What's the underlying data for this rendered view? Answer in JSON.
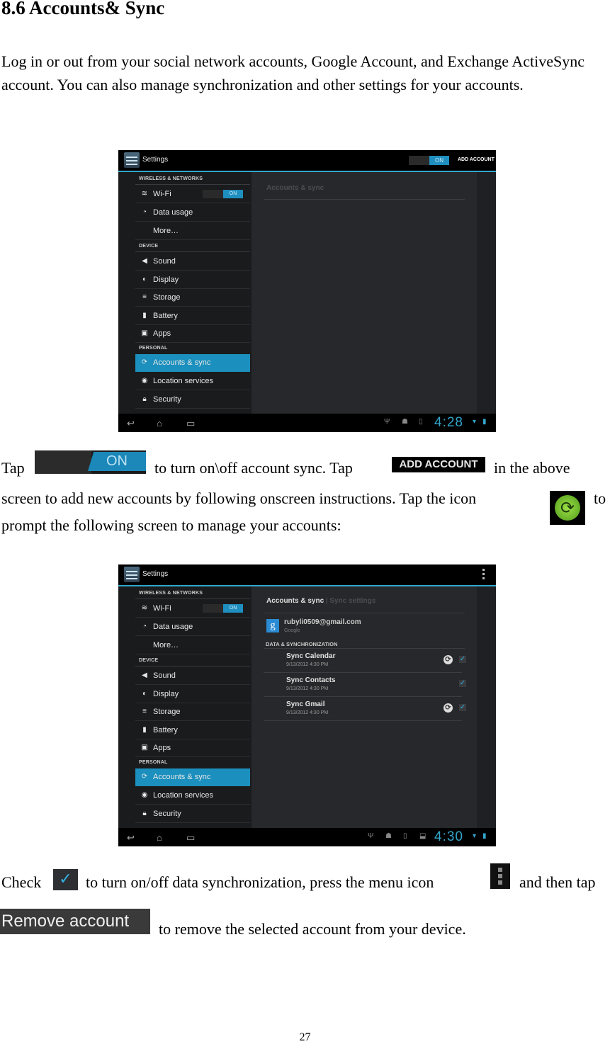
{
  "heading": "8.6 Accounts& Sync",
  "intro": "Log in or out from your social network accounts, Google Account, and Exchange ActiveSync account. You can also manage synchronization and other settings for your accounts.",
  "text": {
    "tap": "Tap",
    "toggle_desc": "to turn on\\off account sync. Tap",
    "in_the_above": "in the above",
    "line2": "screen to add new accounts by following onscreen instructions. Tap the icon",
    "to": "to",
    "line3": "prompt the following screen to manage your accounts:",
    "check": "Check",
    "check_desc": "to turn on/off data synchronization, press the menu icon",
    "and_then_tap": "and then tap",
    "remove_desc": "to remove the selected account from your device."
  },
  "inline_icons": {
    "toggle_on": "ON",
    "add_account": "ADD ACCOUNT",
    "sync_icon": "sync-icon",
    "checkbox_icon": "checkbox-checked-icon",
    "menu_icon": "overflow-menu-icon",
    "remove_account": "Remove account"
  },
  "screens": [
    {
      "app_title": "Settings",
      "toggle": "ON",
      "add_account": "ADD ACCOUNT",
      "content_title": "Accounts & sync",
      "clock": "4:28"
    },
    {
      "app_title": "Settings",
      "tab_active": "Accounts & sync",
      "tab_inactive": "Sync settings",
      "account_email": "rubyli0509@gmail.com",
      "account_type": "Google",
      "data_sync_header": "DATA & SYNCHRONIZATION",
      "sync_items": [
        {
          "name": "Sync Calendar",
          "date": "9/13/2012 4:30 PM",
          "syncing": true,
          "checked": true
        },
        {
          "name": "Sync Contacts",
          "date": "9/13/2012 4:30 PM",
          "syncing": false,
          "checked": true
        },
        {
          "name": "Sync Gmail",
          "date": "9/13/2012 4:30 PM",
          "syncing": true,
          "checked": true
        }
      ],
      "clock": "4:30"
    }
  ],
  "sidebar": {
    "sections": [
      "WIRELESS & NETWORKS",
      "DEVICE",
      "PERSONAL"
    ],
    "items": [
      {
        "label": "Wi-Fi",
        "icon": "wifi-icon",
        "toggle": "ON"
      },
      {
        "label": "Data usage",
        "icon": "data-usage-icon"
      },
      {
        "label": "More…",
        "icon": ""
      },
      {
        "label": "Sound",
        "icon": "sound-icon"
      },
      {
        "label": "Display",
        "icon": "display-icon"
      },
      {
        "label": "Storage",
        "icon": "storage-icon"
      },
      {
        "label": "Battery",
        "icon": "battery-icon"
      },
      {
        "label": "Apps",
        "icon": "apps-icon"
      },
      {
        "label": "Accounts & sync",
        "icon": "sync-icon",
        "selected": true
      },
      {
        "label": "Location services",
        "icon": "location-icon"
      },
      {
        "label": "Security",
        "icon": "lock-icon"
      }
    ]
  },
  "page_number": "27"
}
